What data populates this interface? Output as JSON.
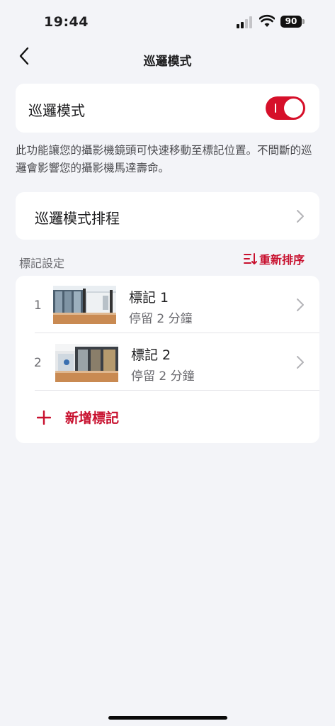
{
  "status_bar": {
    "time": "19:44",
    "battery": "90"
  },
  "header": {
    "title": "巡邏模式"
  },
  "patrol": {
    "label": "巡邏模式",
    "enabled": true,
    "toggle_color": "#d6102a"
  },
  "description": "此功能讓您的攝影機鏡頭可快速移動至標記位置。不間斷的巡邏會影響您的攝影機馬達壽命。",
  "schedule": {
    "label": "巡邏模式排程"
  },
  "markers_section": {
    "label": "標記設定",
    "reorder_label": "重新排序"
  },
  "markers": [
    {
      "index": "1",
      "name": "標記 1",
      "stay": "停留 2 分鐘"
    },
    {
      "index": "2",
      "name": "標記 2",
      "stay": "停留 2 分鐘"
    }
  ],
  "add_marker": {
    "label": "新增標記"
  },
  "colors": {
    "accent": "#c8102e",
    "background": "#f3f4f8"
  }
}
